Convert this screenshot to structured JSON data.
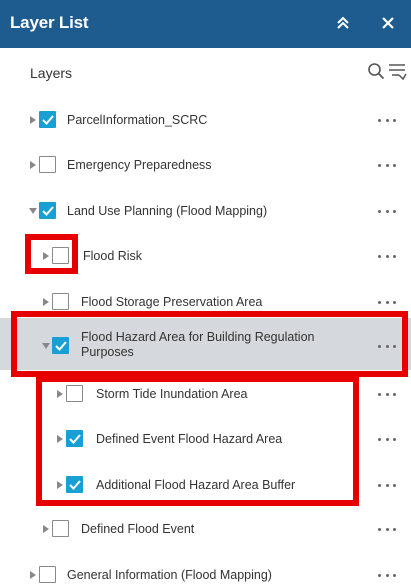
{
  "header": {
    "title": "Layer List",
    "collapse_icon": "double-chevron-up-icon",
    "close_icon": "close-icon"
  },
  "toolbar": {
    "label": "Layers",
    "search_icon": "search-icon",
    "filter_icon": "filter-icon"
  },
  "layers": [
    {
      "label": "ParcelInformation_SCRC",
      "checked": true,
      "level": 0
    },
    {
      "label": "Emergency Preparedness",
      "checked": false,
      "level": 0
    },
    {
      "label": "Land Use Planning (Flood Mapping)",
      "checked": true,
      "level": 0,
      "expanded": true
    },
    {
      "label": "Flood Risk",
      "checked": false,
      "level": 1
    },
    {
      "label": "Flood Storage Preservation Area",
      "checked": false,
      "level": 1
    },
    {
      "label": "Flood Hazard Area for Building Regulation Purposes",
      "checked": true,
      "level": 1,
      "expanded": true,
      "selected": true
    },
    {
      "label": "Storm Tide Inundation Area",
      "checked": false,
      "level": 2
    },
    {
      "label": "Defined Event Flood Hazard Area",
      "checked": true,
      "level": 2
    },
    {
      "label": "Additional Flood Hazard Area Buffer",
      "checked": true,
      "level": 2
    },
    {
      "label": "Defined Flood Event",
      "checked": false,
      "level": 1
    },
    {
      "label": "General Information (Flood Mapping)",
      "checked": false,
      "level": 0
    }
  ],
  "colors": {
    "header": "#1e5b8e",
    "checkbox": "#18a0d4",
    "highlight": "#e60000",
    "selected_row": "#d5d8dc"
  }
}
